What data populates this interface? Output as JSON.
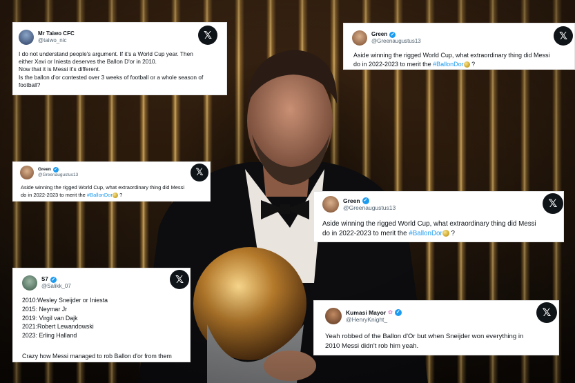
{
  "tweets": [
    {
      "name": "Mr Taiwo CFC",
      "handle": "@taiwo_nic",
      "verified": false,
      "lines": [
        "I do not understand people's argument. If it's a World Cup year. Then",
        "either Xavi or Iniesta deserves the Ballon D'or in 2010.",
        "Now that it is Messi it's different.",
        "Is the ballon d'or contested over 3 weeks of football or a whole season of",
        "football?"
      ]
    },
    {
      "name": "Green",
      "handle": "@Greenaugustus13",
      "verified": true,
      "line1": "Aside winning the rigged World Cup, what extraordinary thing did Messi",
      "line2_pre": "do in 2022-2023 to merit the ",
      "hashtag": "#BallonDor",
      "line2_post": " ?"
    },
    {
      "name": "Green",
      "handle": "@Greenaugustus13",
      "verified": true,
      "line1": "Aside winning the rigged World Cup, what extraordinary thing did Messi",
      "line2_pre": "do in 2022-2023 to merit the ",
      "hashtag": "#BallonDor",
      "line2_post": " ?"
    },
    {
      "name": "Green",
      "handle": "@Greenaugustus13",
      "verified": true,
      "line1": "Aside winning the rigged World Cup, what extraordinary thing did Messi",
      "line2_pre": "do in 2022-2023 to merit the ",
      "hashtag": "#BallonDor",
      "line2_post": " ?"
    },
    {
      "name": "S7",
      "handle": "@Salikk_07",
      "verified": true,
      "lines": [
        "2010:Wesley Sneijder or Iniesta",
        "2015: Neymar Jr",
        "2019: Virgil van Dajk",
        "2021:Robert Lewandowski",
        "2023: Erling Halland"
      ],
      "footer": "Crazy how Messi managed to rob Ballon d'or from them"
    },
    {
      "name": "Kumasi Mayor",
      "handle": "@HenryKnight_",
      "verified": true,
      "lines": [
        "Yeah robbed of the Ballon d'Or but when Sneijder won everything in",
        "2010 Messi didn't rob him yeah."
      ]
    }
  ],
  "x_logo": "𝕏",
  "verified_mark": "✓",
  "icons": {
    "x": "x-logo-icon",
    "verified": "verified-badge-icon",
    "emoji": "ballon-dor-emoji-icon"
  },
  "colors": {
    "hashtag": "#1d9bf0",
    "verified": "#1d9bf0",
    "text": "#0f1419",
    "handle": "#536471"
  }
}
